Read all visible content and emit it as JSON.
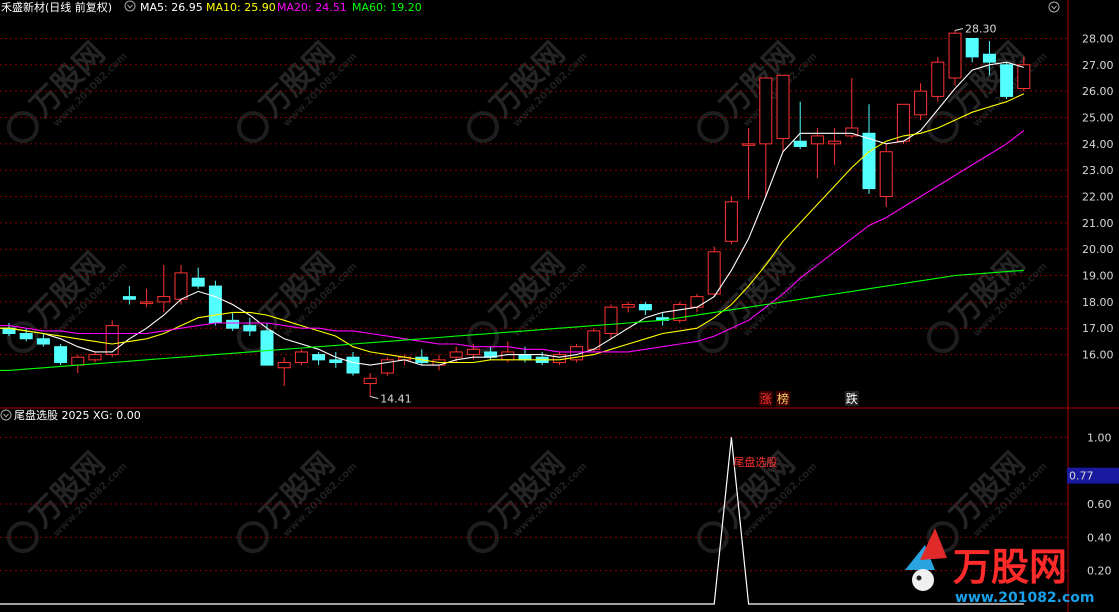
{
  "header": {
    "title": "禾盛新材(日线 前复权)",
    "indicators": [
      {
        "label": "MA5: 26.95",
        "color": "#ffffff"
      },
      {
        "label": "MA10: 25.90",
        "color": "#ffff00"
      },
      {
        "label": "MA20: 24.51",
        "color": "#ff00ff"
      },
      {
        "label": "MA60: 19.20",
        "color": "#00ff00"
      }
    ]
  },
  "sub_header": {
    "title": "尾盘选股 2025 XG: 0.00"
  },
  "colors": {
    "up": "#ff3232",
    "down": "#54ffff",
    "ma5": "#ffffff",
    "ma10": "#ffff00",
    "ma20": "#ff00ff",
    "ma60": "#00ff00",
    "grid": "#8b0000",
    "current_value_box": "#1a1aa0"
  },
  "signals": [
    {
      "text": "涨",
      "bar": 44,
      "color": "#ff3232",
      "bg": "#3a0000"
    },
    {
      "text": "榜",
      "bar": 45,
      "color": "#ffcc66",
      "bg": "#3a0000"
    },
    {
      "text": "跌",
      "bar": 49,
      "color": "#ffffff",
      "bg": "#222222"
    }
  ],
  "sub_annotation": "尾盘选股",
  "watermark": {
    "brand": "万股网",
    "url": "www.201082.com"
  },
  "chart_data": [
    {
      "type": "candlestick",
      "title": "禾盛新材(日线 前复权)",
      "ylim": [
        14.2,
        28.7
      ],
      "y_ticks": [
        16.0,
        17.0,
        18.0,
        19.0,
        20.0,
        21.0,
        22.0,
        23.0,
        24.0,
        25.0,
        26.0,
        27.0,
        28.0
      ],
      "annotations": [
        {
          "text": "28.30",
          "bar": 55,
          "value": 28.3
        },
        {
          "text": "14.41",
          "bar": 21,
          "value": 14.41
        }
      ],
      "candles": [
        [
          17.0,
          17.2,
          16.7,
          16.8
        ],
        [
          16.8,
          17.0,
          16.5,
          16.6
        ],
        [
          16.6,
          16.8,
          16.3,
          16.4
        ],
        [
          16.3,
          16.4,
          15.6,
          15.7
        ],
        [
          15.6,
          16.0,
          15.3,
          15.9
        ],
        [
          15.8,
          16.1,
          15.7,
          16.0
        ],
        [
          16.0,
          17.3,
          15.9,
          17.1
        ],
        [
          18.2,
          18.6,
          17.9,
          18.1
        ],
        [
          18.0,
          18.5,
          17.8,
          18.0
        ],
        [
          18.0,
          19.4,
          17.6,
          18.2
        ],
        [
          18.1,
          19.4,
          17.9,
          19.1
        ],
        [
          18.9,
          19.3,
          18.5,
          18.6
        ],
        [
          18.6,
          18.8,
          17.1,
          17.2
        ],
        [
          17.3,
          17.6,
          16.9,
          17.0
        ],
        [
          17.1,
          17.4,
          16.7,
          16.9
        ],
        [
          16.9,
          17.2,
          15.6,
          15.6
        ],
        [
          15.5,
          15.9,
          14.8,
          15.7
        ],
        [
          15.7,
          16.2,
          15.6,
          16.1
        ],
        [
          16.0,
          16.1,
          15.6,
          15.8
        ],
        [
          15.8,
          16.1,
          15.5,
          15.7
        ],
        [
          15.9,
          16.1,
          15.2,
          15.3
        ],
        [
          14.9,
          15.3,
          14.41,
          15.1
        ],
        [
          15.3,
          15.9,
          15.2,
          15.8
        ],
        [
          15.8,
          16.0,
          15.6,
          15.9
        ],
        [
          15.9,
          16.2,
          15.6,
          15.7
        ],
        [
          15.6,
          16.0,
          15.4,
          15.8
        ],
        [
          15.9,
          16.3,
          15.7,
          16.1
        ],
        [
          16.0,
          16.4,
          15.8,
          16.2
        ],
        [
          16.1,
          16.3,
          15.8,
          15.9
        ],
        [
          15.8,
          16.5,
          15.7,
          16.1
        ],
        [
          16.0,
          16.3,
          15.7,
          15.8
        ],
        [
          15.9,
          16.1,
          15.6,
          15.7
        ],
        [
          15.7,
          16.1,
          15.6,
          16.0
        ],
        [
          15.8,
          16.4,
          15.7,
          16.3
        ],
        [
          16.2,
          17.0,
          16.1,
          16.9
        ],
        [
          16.8,
          17.9,
          16.6,
          17.8
        ],
        [
          17.8,
          18.0,
          17.6,
          17.9
        ],
        [
          17.9,
          18.0,
          17.5,
          17.7
        ],
        [
          17.4,
          17.6,
          17.1,
          17.3
        ],
        [
          17.3,
          18.0,
          17.2,
          17.9
        ],
        [
          17.8,
          18.3,
          17.6,
          18.2
        ],
        [
          18.3,
          20.1,
          18.2,
          19.9
        ],
        [
          20.3,
          22.0,
          20.2,
          21.8
        ],
        [
          24.0,
          24.6,
          21.9,
          24.0
        ],
        [
          24.0,
          26.5,
          22.0,
          26.5
        ],
        [
          24.2,
          26.6,
          23.7,
          26.6
        ],
        [
          24.1,
          25.6,
          23.8,
          23.9
        ],
        [
          24.0,
          24.6,
          22.7,
          24.3
        ],
        [
          24.0,
          24.6,
          23.2,
          24.1
        ],
        [
          24.3,
          26.5,
          24.2,
          24.6
        ],
        [
          24.4,
          25.5,
          22.1,
          22.3
        ],
        [
          22.0,
          24.0,
          21.6,
          23.7
        ],
        [
          24.1,
          25.5,
          24.0,
          25.5
        ],
        [
          25.1,
          26.3,
          24.9,
          26.0
        ],
        [
          25.8,
          27.3,
          25.6,
          27.1
        ],
        [
          26.5,
          28.3,
          26.2,
          28.2
        ],
        [
          28.0,
          28.0,
          27.1,
          27.3
        ],
        [
          27.4,
          27.9,
          26.6,
          27.1
        ],
        [
          27.0,
          27.1,
          25.7,
          25.8
        ],
        [
          26.1,
          27.3,
          26.0,
          27.0
        ]
      ],
      "series": [
        {
          "name": "MA5",
          "values": [
            17.0,
            16.9,
            16.8,
            16.6,
            16.3,
            16.1,
            16.1,
            16.6,
            17.0,
            17.5,
            18.1,
            18.4,
            18.2,
            17.9,
            17.5,
            17.0,
            16.6,
            16.4,
            16.2,
            15.9,
            15.7,
            15.6,
            15.7,
            15.8,
            15.6,
            15.6,
            15.8,
            15.9,
            15.9,
            16.0,
            16.0,
            16.0,
            15.9,
            16.0,
            16.2,
            16.6,
            17.0,
            17.4,
            17.6,
            17.7,
            17.8,
            18.2,
            19.2,
            20.4,
            22.0,
            23.7,
            24.4,
            24.4,
            24.4,
            24.4,
            24.2,
            24.0,
            24.1,
            24.5,
            25.3,
            26.1,
            26.8,
            27.0,
            27.1,
            26.9
          ]
        },
        {
          "name": "MA10",
          "values": [
            17.0,
            16.9,
            16.8,
            16.7,
            16.6,
            16.5,
            16.4,
            16.5,
            16.6,
            16.8,
            17.1,
            17.4,
            17.5,
            17.6,
            17.6,
            17.5,
            17.3,
            17.1,
            16.9,
            16.7,
            16.3,
            16.1,
            16.0,
            15.9,
            15.8,
            15.7,
            15.7,
            15.7,
            15.8,
            15.8,
            15.8,
            15.8,
            15.8,
            15.9,
            16.0,
            16.2,
            16.4,
            16.6,
            16.8,
            16.9,
            17.0,
            17.4,
            17.9,
            18.6,
            19.4,
            20.3,
            21.0,
            21.7,
            22.4,
            23.1,
            23.7,
            24.1,
            24.3,
            24.4,
            24.6,
            24.9,
            25.2,
            25.4,
            25.6,
            25.9
          ]
        },
        {
          "name": "MA20",
          "values": [
            17.1,
            17.0,
            16.9,
            16.9,
            16.8,
            16.8,
            16.8,
            16.8,
            16.8,
            16.9,
            17.0,
            17.1,
            17.2,
            17.2,
            17.2,
            17.2,
            17.1,
            17.0,
            17.0,
            16.9,
            16.9,
            16.8,
            16.7,
            16.6,
            16.5,
            16.4,
            16.4,
            16.3,
            16.3,
            16.3,
            16.2,
            16.2,
            16.1,
            16.1,
            16.1,
            16.1,
            16.1,
            16.2,
            16.3,
            16.4,
            16.5,
            16.7,
            17.0,
            17.3,
            17.8,
            18.3,
            18.9,
            19.4,
            19.9,
            20.4,
            20.9,
            21.2,
            21.6,
            22.0,
            22.4,
            22.8,
            23.2,
            23.6,
            24.0,
            24.5
          ]
        },
        {
          "name": "MA60",
          "values": [
            15.4,
            15.45,
            15.5,
            15.55,
            15.6,
            15.65,
            15.7,
            15.75,
            15.8,
            15.85,
            15.9,
            15.95,
            16.0,
            16.05,
            16.1,
            16.15,
            16.2,
            16.25,
            16.3,
            16.35,
            16.4,
            16.45,
            16.5,
            16.55,
            16.6,
            16.65,
            16.7,
            16.75,
            16.8,
            16.85,
            16.9,
            16.95,
            17.0,
            17.05,
            17.1,
            17.15,
            17.2,
            17.25,
            17.3,
            17.4,
            17.5,
            17.6,
            17.7,
            17.8,
            17.9,
            18.0,
            18.1,
            18.2,
            18.3,
            18.4,
            18.5,
            18.6,
            18.7,
            18.8,
            18.9,
            19.0,
            19.05,
            19.1,
            19.15,
            19.2
          ]
        }
      ]
    },
    {
      "type": "line",
      "title": "尾盘选股 2025 XG: 0.00",
      "name": "XG",
      "ylim": [
        0,
        1.08
      ],
      "y_ticks": [
        1.0,
        0.77,
        0.6,
        0.4,
        0.2
      ],
      "current_value": "0.77",
      "values": [
        0,
        0,
        0,
        0,
        0,
        0,
        0,
        0,
        0,
        0,
        0,
        0,
        0,
        0,
        0,
        0,
        0,
        0,
        0,
        0,
        0,
        0,
        0,
        0,
        0,
        0,
        0,
        0,
        0,
        0,
        0,
        0,
        0,
        0,
        0,
        0,
        0,
        0,
        0,
        0,
        0,
        0,
        1,
        0,
        0,
        0,
        0,
        0,
        0,
        0,
        0,
        0,
        0,
        0,
        0,
        0,
        0,
        0,
        0,
        0
      ]
    }
  ]
}
